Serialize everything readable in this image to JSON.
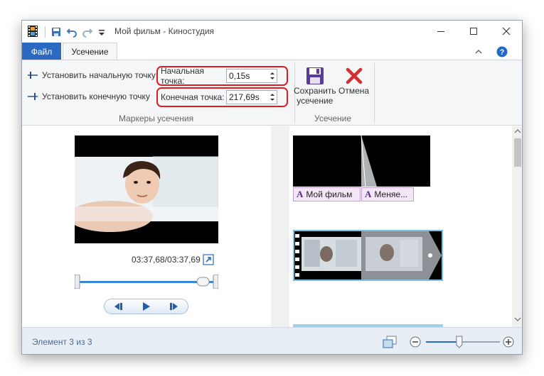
{
  "window": {
    "title": "Мой фильм - Киностудия"
  },
  "tabs": {
    "file": "Файл",
    "trim": "Усечение"
  },
  "ribbon": {
    "set_start": "Установить начальную точку",
    "set_end": "Установить конечную точку",
    "start_label": "Начальная точка:",
    "start_value": "0,15s",
    "end_label": "Конечная точка:",
    "end_value": "217,69s",
    "group_markers": "Маркеры усечения",
    "save_label_line1": "Сохранить",
    "save_label_line2": "усечение",
    "cancel_label": "Отмена",
    "group_trim": "Усечение"
  },
  "preview": {
    "timecode": "03:37,68/03:37,69"
  },
  "storyboard": {
    "caption_1": "Мой фильм",
    "caption_2": "Меняе..."
  },
  "status": {
    "text": "Элемент 3 из 3",
    "zoom_level": 0.45
  },
  "colors": {
    "file_tab": "#2b6ac3",
    "highlight": "#d91e24",
    "selection": "#7ac1de",
    "caption_bg": "#f3e6f7"
  }
}
